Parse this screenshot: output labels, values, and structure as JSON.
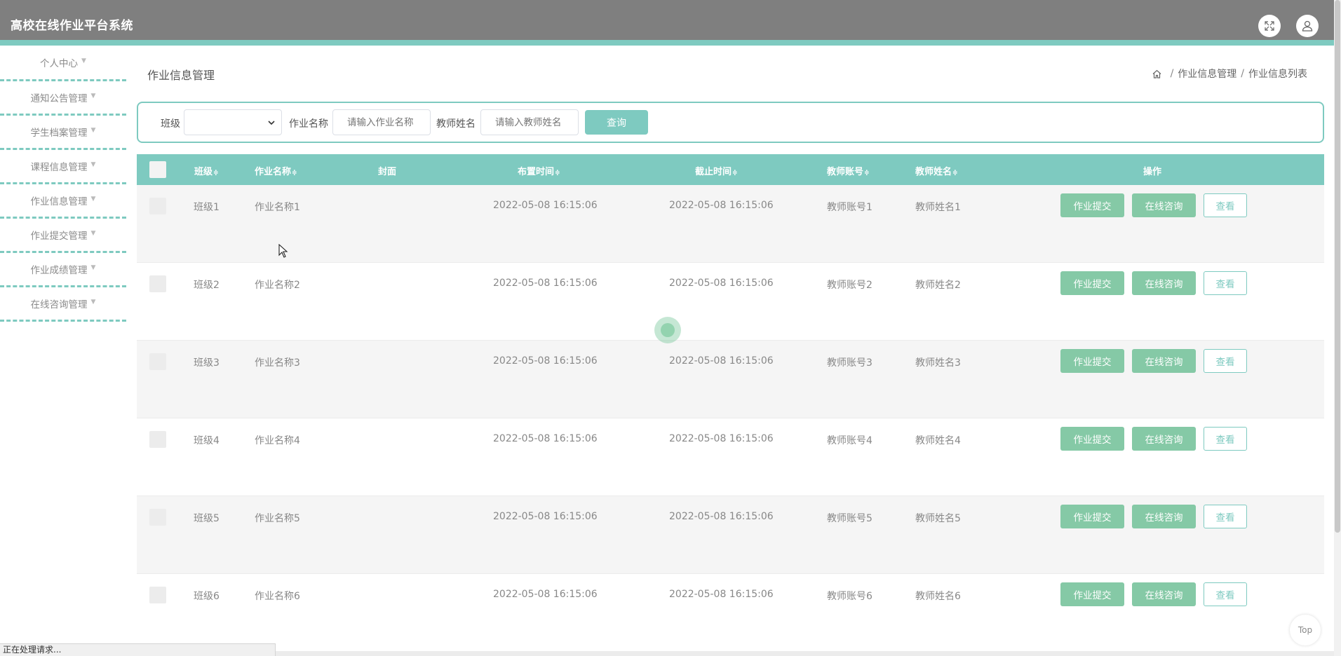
{
  "app": {
    "title": "高校在线作业平台系统"
  },
  "header": {
    "fullscreen_icon": "fullscreen-icon",
    "user_icon": "user-avatar-icon"
  },
  "sidebar": {
    "items": [
      {
        "label": "个人中心"
      },
      {
        "label": "通知公告管理"
      },
      {
        "label": "学生档案管理"
      },
      {
        "label": "课程信息管理"
      },
      {
        "label": "作业信息管理"
      },
      {
        "label": "作业提交管理"
      },
      {
        "label": "作业成绩管理"
      },
      {
        "label": "在线咨询管理"
      }
    ]
  },
  "page": {
    "title": "作业信息管理"
  },
  "breadcrumb": {
    "home_icon": "home-icon",
    "items": [
      "作业信息管理",
      "作业信息列表"
    ]
  },
  "search": {
    "class_label": "班级",
    "class_value": "",
    "name_label": "作业名称",
    "name_placeholder": "请输入作业名称",
    "teacher_label": "教师姓名",
    "teacher_placeholder": "请输入教师姓名",
    "button": "查询"
  },
  "table": {
    "columns": [
      "班级",
      "作业名称",
      "封面",
      "布置时间",
      "截止时间",
      "教师账号",
      "教师姓名",
      "操作"
    ],
    "sort_icon": "≑",
    "actions": {
      "submit": "作业提交",
      "consult": "在线咨询",
      "view": "查看"
    },
    "rows": [
      {
        "class": "班级1",
        "name": "作业名称1",
        "assign_time": "2022-05-08 16:15:06",
        "deadline": "2022-05-08 16:15:06",
        "teacher_account": "教师账号1",
        "teacher_name": "教师姓名1"
      },
      {
        "class": "班级2",
        "name": "作业名称2",
        "assign_time": "2022-05-08 16:15:06",
        "deadline": "2022-05-08 16:15:06",
        "teacher_account": "教师账号2",
        "teacher_name": "教师姓名2"
      },
      {
        "class": "班级3",
        "name": "作业名称3",
        "assign_time": "2022-05-08 16:15:06",
        "deadline": "2022-05-08 16:15:06",
        "teacher_account": "教师账号3",
        "teacher_name": "教师姓名3"
      },
      {
        "class": "班级4",
        "name": "作业名称4",
        "assign_time": "2022-05-08 16:15:06",
        "deadline": "2022-05-08 16:15:06",
        "teacher_account": "教师账号4",
        "teacher_name": "教师姓名4"
      },
      {
        "class": "班级5",
        "name": "作业名称5",
        "assign_time": "2022-05-08 16:15:06",
        "deadline": "2022-05-08 16:15:06",
        "teacher_account": "教师账号5",
        "teacher_name": "教师姓名5"
      },
      {
        "class": "班级6",
        "name": "作业名称6",
        "assign_time": "2022-05-08 16:15:06",
        "deadline": "2022-05-08 16:15:06",
        "teacher_account": "教师账号6",
        "teacher_name": "教师姓名6"
      }
    ]
  },
  "back_to_top": {
    "label": "Top"
  },
  "status_bar": {
    "text": "正在处理请求..."
  },
  "colors": {
    "header": "#7f7f7f",
    "accent": "#7ecac0",
    "action": "#85c9a6"
  }
}
